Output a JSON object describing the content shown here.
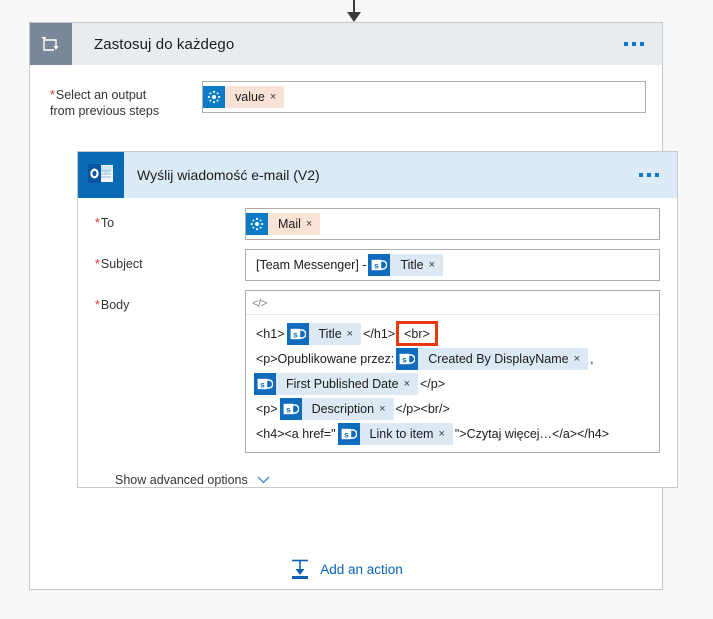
{
  "connector": {
    "icon": "down-arrow-icon"
  },
  "foreach_card": {
    "icon": "loop-repeat-icon",
    "title": "Zastosuj do każdego",
    "overflow_icon": "ellipsis-icon",
    "select_output": {
      "label_required_marker": "*",
      "label_line1": "Select an output",
      "label_line2": "from previous steps",
      "token": {
        "icon": "flow-dynamic-content-icon",
        "text": "value",
        "remove_icon": "×"
      }
    }
  },
  "email_card": {
    "icon": "outlook-icon",
    "title": "Wyślij wiadomość e-mail (V2)",
    "overflow_icon": "ellipsis-icon",
    "to": {
      "label_required_marker": "*",
      "label": "To",
      "token": {
        "icon": "flow-dynamic-content-icon",
        "text": "Mail",
        "remove_icon": "×"
      }
    },
    "subject": {
      "label_required_marker": "*",
      "label": "Subject",
      "prefix_text": "[Team Messenger] -",
      "token": {
        "icon": "sharepoint-icon",
        "text": "Title",
        "remove_icon": "×"
      }
    },
    "body": {
      "label_required_marker": "*",
      "label": "Body",
      "toolbar_code_icon": "</>",
      "lines": [
        {
          "segments": [
            {
              "kind": "text",
              "value": "<h1>"
            },
            {
              "kind": "token",
              "icon": "sharepoint-icon",
              "text": "Title",
              "remove_icon": "×"
            },
            {
              "kind": "text",
              "value": "</h1>"
            },
            {
              "kind": "highlight",
              "value": "<br>"
            }
          ]
        },
        {
          "segments": [
            {
              "kind": "text",
              "value": "<p>Opublikowane przez:"
            },
            {
              "kind": "token",
              "icon": "sharepoint-icon",
              "text": "Created By DisplayName",
              "remove_icon": "×"
            },
            {
              "kind": "text",
              "value": ","
            }
          ]
        },
        {
          "segments": [
            {
              "kind": "token",
              "icon": "sharepoint-icon",
              "text": "First Published Date",
              "remove_icon": "×"
            },
            {
              "kind": "text",
              "value": "</p>"
            }
          ]
        },
        {
          "segments": [
            {
              "kind": "text",
              "value": "<p>"
            },
            {
              "kind": "token",
              "icon": "sharepoint-icon",
              "text": "Description",
              "remove_icon": "×"
            },
            {
              "kind": "text",
              "value": "</p><br/>"
            }
          ]
        },
        {
          "segments": [
            {
              "kind": "text",
              "value": "<h4><a href=\""
            },
            {
              "kind": "token",
              "icon": "sharepoint-icon",
              "text": "Link to item",
              "remove_icon": "×"
            },
            {
              "kind": "text",
              "value": "\">Czytaj więcej…</a></h4>"
            }
          ]
        }
      ]
    },
    "advanced": {
      "label": "Show advanced options",
      "chevron_icon": "chevron-down-icon"
    }
  },
  "add_action": {
    "icon": "insert-below-icon",
    "label": "Add an action"
  },
  "colors": {
    "page_bg": "#f7f7f7",
    "foreach_header_bg": "#e9ecef",
    "foreach_icon_bg": "#7a8699",
    "email_header_bg": "#dceaf7",
    "email_icon_bg": "#0a6bb5",
    "flow_token_bg": "#fbe2d7",
    "flow_token_icon_bg": "#0a7bc4",
    "sp_token_bg": "#dce8f3",
    "sp_token_icon_bg": "#0f6cbd",
    "highlight_border": "#e8380d",
    "link_blue": "#0b62b5",
    "required_red": "#d13438"
  }
}
